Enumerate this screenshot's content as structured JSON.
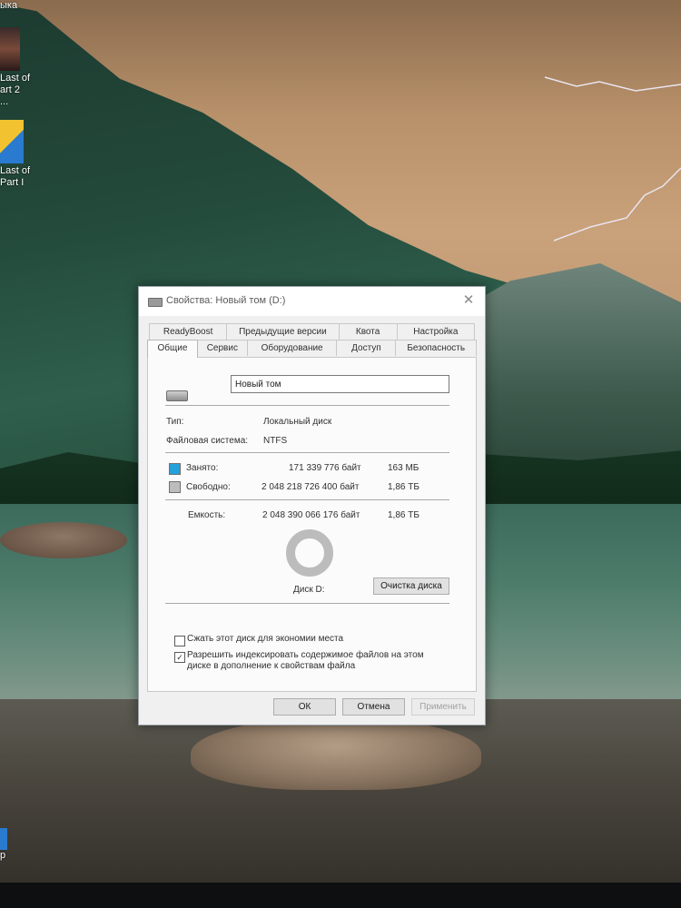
{
  "desktop": {
    "top_label": "ыка",
    "icons": [
      {
        "label": "Last of\nart 2 ..."
      },
      {
        "label": "Last of\nPart I"
      }
    ],
    "bottom_label": "р"
  },
  "dialog": {
    "title": "Свойства: Новый том (D:)",
    "close_glyph": "✕",
    "tabs_back": [
      "ReadyBoost",
      "Предыдущие версии",
      "Квота",
      "Настройка"
    ],
    "tabs_front": [
      "Общие",
      "Сервис",
      "Оборудование",
      "Доступ",
      "Безопасность"
    ],
    "active_tab": "Общие",
    "volume_name": "Новый том",
    "type_label": "Тип:",
    "type_value": "Локальный диск",
    "fs_label": "Файловая система:",
    "fs_value": "NTFS",
    "used": {
      "label": "Занято:",
      "bytes": "171 339 776 байт",
      "size": "163 МБ",
      "color": "#26a0da"
    },
    "free": {
      "label": "Свободно:",
      "bytes": "2 048 218 726 400 байт",
      "size": "1,86 ТБ",
      "color": "#bcbcbc"
    },
    "capacity": {
      "label": "Емкость:",
      "bytes": "2 048 390 066 176 байт",
      "size": "1,86 ТБ"
    },
    "used_fraction": 0.0001,
    "disk_label": "Диск D:",
    "cleanup_button": "Очистка диска",
    "compress_label": "Сжать этот диск для экономии места",
    "compress_checked": false,
    "index_label_line1": "Разрешить индексировать содержимое файлов на этом",
    "index_label_line2": "диске в дополнение к свойствам файла",
    "index_checked": true,
    "ok_button": "ОК",
    "cancel_button": "Отмена",
    "apply_button": "Применить"
  }
}
